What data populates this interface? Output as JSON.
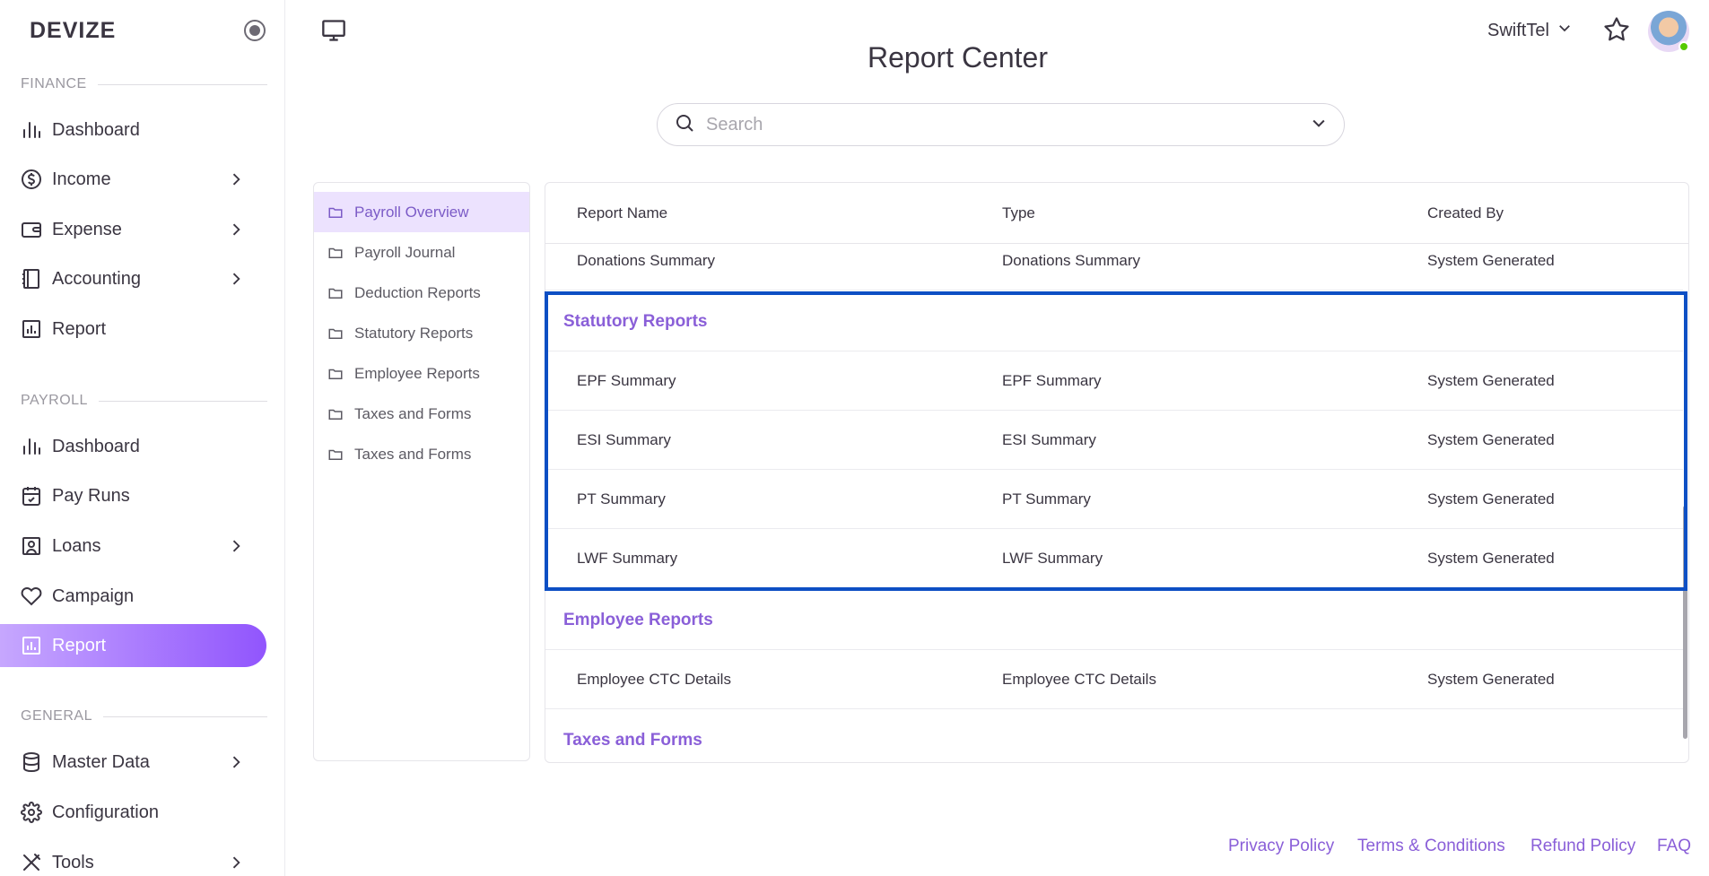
{
  "brand": "DEVIZE",
  "sidebar": {
    "sections": [
      {
        "title": "FINANCE"
      },
      {
        "title": "PAYROLL"
      },
      {
        "title": "GENERAL"
      }
    ],
    "finance_items": [
      {
        "label": "Dashboard",
        "icon": "bar-chart-icon"
      },
      {
        "label": "Income",
        "icon": "dollar-circle-icon"
      },
      {
        "label": "Expense",
        "icon": "wallet-icon"
      },
      {
        "label": "Accounting",
        "icon": "ledger-icon"
      },
      {
        "label": "Report",
        "icon": "report-icon"
      }
    ],
    "payroll_items": [
      {
        "label": "Dashboard",
        "icon": "bar-chart-icon"
      },
      {
        "label": "Pay Runs",
        "icon": "calendar-check-icon"
      },
      {
        "label": "Loans",
        "icon": "id-card-icon"
      },
      {
        "label": "Campaign",
        "icon": "heart-icon"
      },
      {
        "label": "Report",
        "icon": "report-icon"
      }
    ],
    "general_items": [
      {
        "label": "Master Data",
        "icon": "database-icon"
      },
      {
        "label": "Configuration",
        "icon": "gear-icon"
      },
      {
        "label": "Tools",
        "icon": "tools-icon"
      }
    ],
    "active_color": "#9155fd"
  },
  "header": {
    "title": "Report Center",
    "company": "SwiftTel"
  },
  "search": {
    "placeholder": "Search"
  },
  "folders": [
    "Payroll Overview",
    "Payroll Journal",
    "Deduction Reports",
    "Statutory Reports",
    "Employee Reports",
    "Taxes and Forms",
    "Taxes and Forms"
  ],
  "table": {
    "headers": [
      "Report Name",
      "Type",
      "Created By"
    ],
    "rows": [
      {
        "name": "Donations Summary",
        "type": "Donations Summary",
        "created_by": "System Generated"
      },
      {
        "group": "Statutory Reports"
      },
      {
        "name": "EPF Summary",
        "type": "EPF Summary",
        "created_by": "System Generated"
      },
      {
        "name": "ESI Summary",
        "type": "ESI Summary",
        "created_by": "System Generated"
      },
      {
        "name": "PT Summary",
        "type": "PT Summary",
        "created_by": "System Generated"
      },
      {
        "name": "LWF Summary",
        "type": "LWF Summary",
        "created_by": "System Generated"
      },
      {
        "group": "Employee Reports"
      },
      {
        "name": "Employee CTC Details",
        "type": "Employee CTC Details",
        "created_by": "System Generated"
      },
      {
        "group": "Taxes and Forms"
      }
    ]
  },
  "footer": {
    "links": [
      "Privacy Policy",
      "Terms & Conditions",
      "Refund Policy",
      "FAQ"
    ]
  },
  "colors": {
    "accent": "#8a5fd8",
    "highlight_border": "#0d4fc4"
  }
}
